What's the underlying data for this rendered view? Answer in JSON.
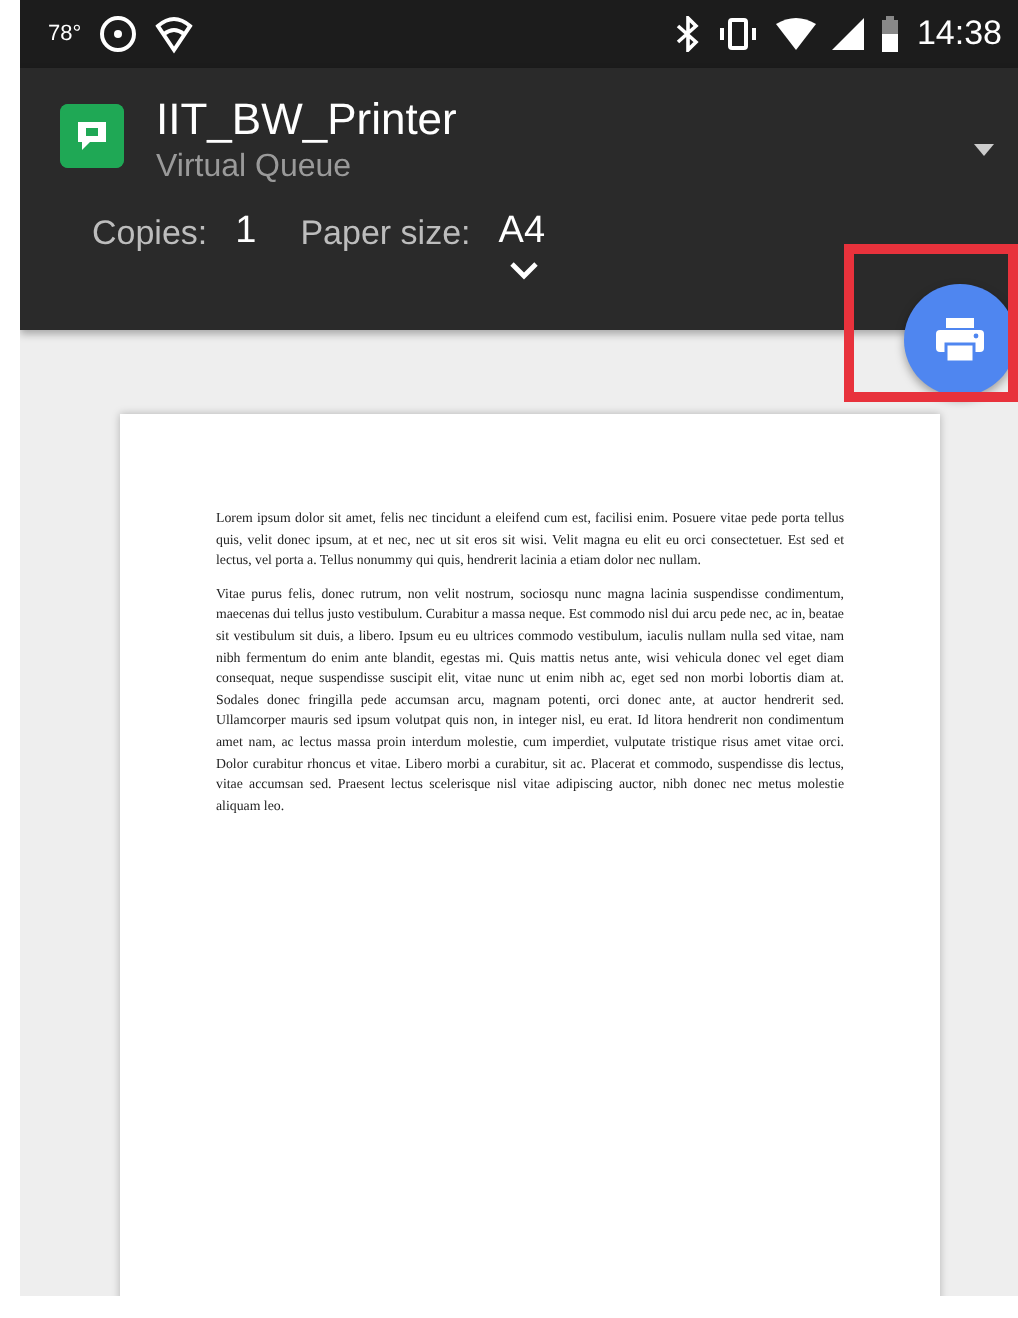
{
  "status_bar": {
    "temperature": "78°",
    "time": "14:38"
  },
  "printer": {
    "name": "IIT_BW_Printer",
    "queue": "Virtual Queue"
  },
  "settings": [
    {
      "label": "Copies:",
      "value": "1"
    },
    {
      "label": "Paper size:",
      "value": "A4"
    }
  ],
  "document": {
    "paragraphs": [
      "Lorem ipsum dolor sit amet, felis nec tincidunt a eleifend cum est, facilisi enim. Posuere vitae pede porta tellus quis, velit donec ipsum, at et nec, nec ut sit eros sit wisi. Velit magna eu elit eu orci consectetuer. Est sed et lectus, vel porta a. Tellus nonummy qui quis, hendrerit lacinia a etiam dolor nec nullam.",
      "Vitae purus felis, donec rutrum, non velit nostrum, sociosqu nunc magna lacinia suspendisse condimentum, maecenas dui tellus justo vestibulum. Curabitur a massa neque. Est commodo nisl dui arcu pede nec, ac in, beatae sit vestibulum sit duis, a libero. Ipsum eu eu ultrices commodo vestibulum, iaculis nullam nulla sed vitae, nam nibh fermentum do enim ante blandit, egestas mi. Quis mattis netus ante, wisi vehicula donec vel eget diam consequat, neque suspendisse suscipit elit, vitae nunc ut enim nibh ac, eget sed non morbi lobortis diam at. Sodales donec fringilla pede accumsan arcu, magnam potenti, orci donec ante, at auctor hendrerit sed. Ullamcorper mauris sed ipsum volutpat quis non, in integer nisl, eu erat. Id litora hendrerit non condimentum amet nam, ac lectus massa proin interdum molestie, cum imperdiet, vulputate tristique risus amet vitae orci. Dolor curabitur rhoncus et vitae. Libero morbi a curabitur, sit ac. Placerat et commodo, suspendisse dis lectus, vitae accumsan sed. Praesent lectus scelerisque nisl vitae adipiscing auctor, nibh donec nec metus molestie aliquam leo."
    ]
  }
}
